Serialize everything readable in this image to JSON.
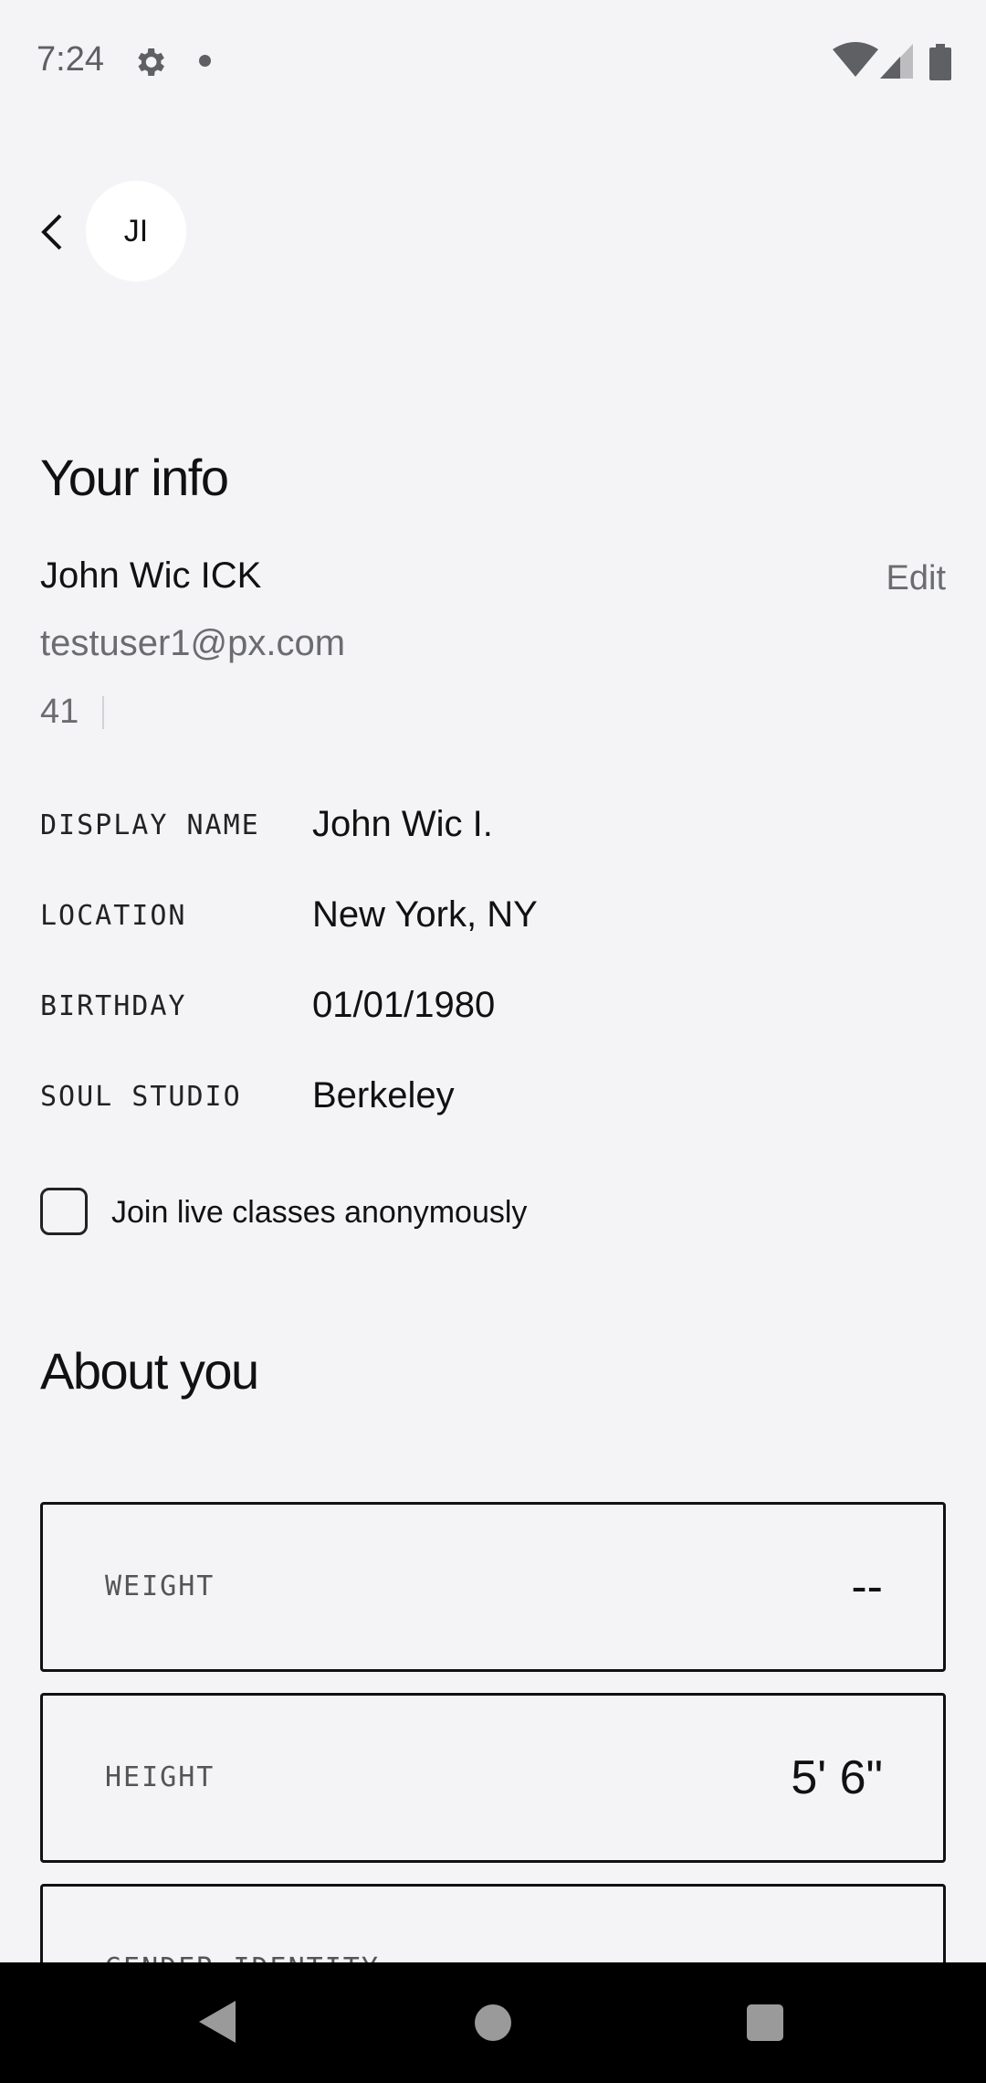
{
  "status_bar": {
    "time": "7:24"
  },
  "profile": {
    "initials": "JI"
  },
  "your_info": {
    "title": "Your info",
    "name": "John Wic ICK",
    "edit_label": "Edit",
    "email": "testuser1@px.com",
    "age": "41"
  },
  "details": [
    {
      "label": "DISPLAY NAME",
      "value": "John Wic I."
    },
    {
      "label": "LOCATION",
      "value": "New York, NY"
    },
    {
      "label": "BIRTHDAY",
      "value": "01/01/1980"
    },
    {
      "label": "SOUL STUDIO",
      "value": "Berkeley"
    }
  ],
  "anonymous": {
    "label": "Join live classes anonymously",
    "checked": false
  },
  "about_you": {
    "title": "About you",
    "fields": [
      {
        "label": "WEIGHT",
        "value": "--"
      },
      {
        "label": "HEIGHT",
        "value": "5' 6\""
      },
      {
        "label": "GENDER IDENTITY",
        "value": ""
      }
    ]
  },
  "colors": {
    "background": "#f4f4f6",
    "secondary_text": "#6b6c70",
    "nav_bar": "#000000"
  }
}
